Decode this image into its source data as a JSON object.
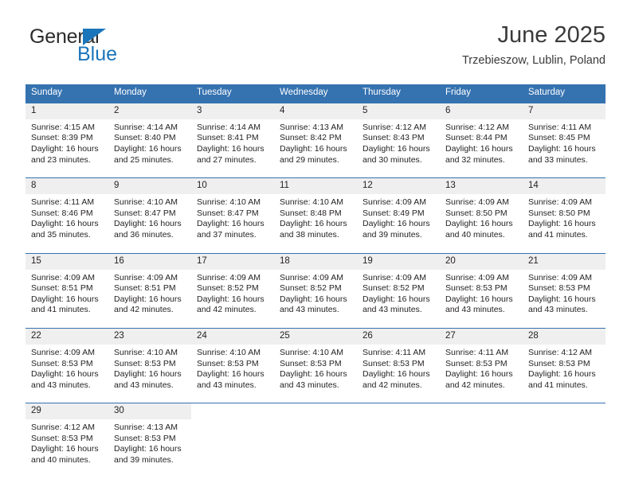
{
  "brand": {
    "name_part1": "General",
    "name_part2": "Blue",
    "triangle_color": "#1b75bb"
  },
  "header": {
    "title": "June 2025",
    "subtitle": "Trzebieszow, Lublin, Poland"
  },
  "theme": {
    "header_blue": "#3572b0",
    "daynum_gray": "#efefef",
    "text": "#231f20"
  },
  "calendar": {
    "weekday_headers": [
      "Sunday",
      "Monday",
      "Tuesday",
      "Wednesday",
      "Thursday",
      "Friday",
      "Saturday"
    ],
    "labels": {
      "sunrise_prefix": "Sunrise:",
      "sunset_prefix": "Sunset:",
      "daylight_prefix": "Daylight:"
    },
    "weeks": [
      {
        "days": [
          {
            "num": "1",
            "sunrise": "Sunrise: 4:15 AM",
            "sunset": "Sunset: 8:39 PM",
            "daylight_line1": "Daylight: 16 hours",
            "daylight_line2": "and 23 minutes."
          },
          {
            "num": "2",
            "sunrise": "Sunrise: 4:14 AM",
            "sunset": "Sunset: 8:40 PM",
            "daylight_line1": "Daylight: 16 hours",
            "daylight_line2": "and 25 minutes."
          },
          {
            "num": "3",
            "sunrise": "Sunrise: 4:14 AM",
            "sunset": "Sunset: 8:41 PM",
            "daylight_line1": "Daylight: 16 hours",
            "daylight_line2": "and 27 minutes."
          },
          {
            "num": "4",
            "sunrise": "Sunrise: 4:13 AM",
            "sunset": "Sunset: 8:42 PM",
            "daylight_line1": "Daylight: 16 hours",
            "daylight_line2": "and 29 minutes."
          },
          {
            "num": "5",
            "sunrise": "Sunrise: 4:12 AM",
            "sunset": "Sunset: 8:43 PM",
            "daylight_line1": "Daylight: 16 hours",
            "daylight_line2": "and 30 minutes."
          },
          {
            "num": "6",
            "sunrise": "Sunrise: 4:12 AM",
            "sunset": "Sunset: 8:44 PM",
            "daylight_line1": "Daylight: 16 hours",
            "daylight_line2": "and 32 minutes."
          },
          {
            "num": "7",
            "sunrise": "Sunrise: 4:11 AM",
            "sunset": "Sunset: 8:45 PM",
            "daylight_line1": "Daylight: 16 hours",
            "daylight_line2": "and 33 minutes."
          }
        ]
      },
      {
        "days": [
          {
            "num": "8",
            "sunrise": "Sunrise: 4:11 AM",
            "sunset": "Sunset: 8:46 PM",
            "daylight_line1": "Daylight: 16 hours",
            "daylight_line2": "and 35 minutes."
          },
          {
            "num": "9",
            "sunrise": "Sunrise: 4:10 AM",
            "sunset": "Sunset: 8:47 PM",
            "daylight_line1": "Daylight: 16 hours",
            "daylight_line2": "and 36 minutes."
          },
          {
            "num": "10",
            "sunrise": "Sunrise: 4:10 AM",
            "sunset": "Sunset: 8:47 PM",
            "daylight_line1": "Daylight: 16 hours",
            "daylight_line2": "and 37 minutes."
          },
          {
            "num": "11",
            "sunrise": "Sunrise: 4:10 AM",
            "sunset": "Sunset: 8:48 PM",
            "daylight_line1": "Daylight: 16 hours",
            "daylight_line2": "and 38 minutes."
          },
          {
            "num": "12",
            "sunrise": "Sunrise: 4:09 AM",
            "sunset": "Sunset: 8:49 PM",
            "daylight_line1": "Daylight: 16 hours",
            "daylight_line2": "and 39 minutes."
          },
          {
            "num": "13",
            "sunrise": "Sunrise: 4:09 AM",
            "sunset": "Sunset: 8:50 PM",
            "daylight_line1": "Daylight: 16 hours",
            "daylight_line2": "and 40 minutes."
          },
          {
            "num": "14",
            "sunrise": "Sunrise: 4:09 AM",
            "sunset": "Sunset: 8:50 PM",
            "daylight_line1": "Daylight: 16 hours",
            "daylight_line2": "and 41 minutes."
          }
        ]
      },
      {
        "days": [
          {
            "num": "15",
            "sunrise": "Sunrise: 4:09 AM",
            "sunset": "Sunset: 8:51 PM",
            "daylight_line1": "Daylight: 16 hours",
            "daylight_line2": "and 41 minutes."
          },
          {
            "num": "16",
            "sunrise": "Sunrise: 4:09 AM",
            "sunset": "Sunset: 8:51 PM",
            "daylight_line1": "Daylight: 16 hours",
            "daylight_line2": "and 42 minutes."
          },
          {
            "num": "17",
            "sunrise": "Sunrise: 4:09 AM",
            "sunset": "Sunset: 8:52 PM",
            "daylight_line1": "Daylight: 16 hours",
            "daylight_line2": "and 42 minutes."
          },
          {
            "num": "18",
            "sunrise": "Sunrise: 4:09 AM",
            "sunset": "Sunset: 8:52 PM",
            "daylight_line1": "Daylight: 16 hours",
            "daylight_line2": "and 43 minutes."
          },
          {
            "num": "19",
            "sunrise": "Sunrise: 4:09 AM",
            "sunset": "Sunset: 8:52 PM",
            "daylight_line1": "Daylight: 16 hours",
            "daylight_line2": "and 43 minutes."
          },
          {
            "num": "20",
            "sunrise": "Sunrise: 4:09 AM",
            "sunset": "Sunset: 8:53 PM",
            "daylight_line1": "Daylight: 16 hours",
            "daylight_line2": "and 43 minutes."
          },
          {
            "num": "21",
            "sunrise": "Sunrise: 4:09 AM",
            "sunset": "Sunset: 8:53 PM",
            "daylight_line1": "Daylight: 16 hours",
            "daylight_line2": "and 43 minutes."
          }
        ]
      },
      {
        "days": [
          {
            "num": "22",
            "sunrise": "Sunrise: 4:09 AM",
            "sunset": "Sunset: 8:53 PM",
            "daylight_line1": "Daylight: 16 hours",
            "daylight_line2": "and 43 minutes."
          },
          {
            "num": "23",
            "sunrise": "Sunrise: 4:10 AM",
            "sunset": "Sunset: 8:53 PM",
            "daylight_line1": "Daylight: 16 hours",
            "daylight_line2": "and 43 minutes."
          },
          {
            "num": "24",
            "sunrise": "Sunrise: 4:10 AM",
            "sunset": "Sunset: 8:53 PM",
            "daylight_line1": "Daylight: 16 hours",
            "daylight_line2": "and 43 minutes."
          },
          {
            "num": "25",
            "sunrise": "Sunrise: 4:10 AM",
            "sunset": "Sunset: 8:53 PM",
            "daylight_line1": "Daylight: 16 hours",
            "daylight_line2": "and 43 minutes."
          },
          {
            "num": "26",
            "sunrise": "Sunrise: 4:11 AM",
            "sunset": "Sunset: 8:53 PM",
            "daylight_line1": "Daylight: 16 hours",
            "daylight_line2": "and 42 minutes."
          },
          {
            "num": "27",
            "sunrise": "Sunrise: 4:11 AM",
            "sunset": "Sunset: 8:53 PM",
            "daylight_line1": "Daylight: 16 hours",
            "daylight_line2": "and 42 minutes."
          },
          {
            "num": "28",
            "sunrise": "Sunrise: 4:12 AM",
            "sunset": "Sunset: 8:53 PM",
            "daylight_line1": "Daylight: 16 hours",
            "daylight_line2": "and 41 minutes."
          }
        ]
      },
      {
        "days": [
          {
            "num": "29",
            "sunrise": "Sunrise: 4:12 AM",
            "sunset": "Sunset: 8:53 PM",
            "daylight_line1": "Daylight: 16 hours",
            "daylight_line2": "and 40 minutes."
          },
          {
            "num": "30",
            "sunrise": "Sunrise: 4:13 AM",
            "sunset": "Sunset: 8:53 PM",
            "daylight_line1": "Daylight: 16 hours",
            "daylight_line2": "and 39 minutes."
          },
          {
            "num": "",
            "sunrise": "",
            "sunset": "",
            "daylight_line1": "",
            "daylight_line2": ""
          },
          {
            "num": "",
            "sunrise": "",
            "sunset": "",
            "daylight_line1": "",
            "daylight_line2": ""
          },
          {
            "num": "",
            "sunrise": "",
            "sunset": "",
            "daylight_line1": "",
            "daylight_line2": ""
          },
          {
            "num": "",
            "sunrise": "",
            "sunset": "",
            "daylight_line1": "",
            "daylight_line2": ""
          },
          {
            "num": "",
            "sunrise": "",
            "sunset": "",
            "daylight_line1": "",
            "daylight_line2": ""
          }
        ]
      }
    ]
  }
}
